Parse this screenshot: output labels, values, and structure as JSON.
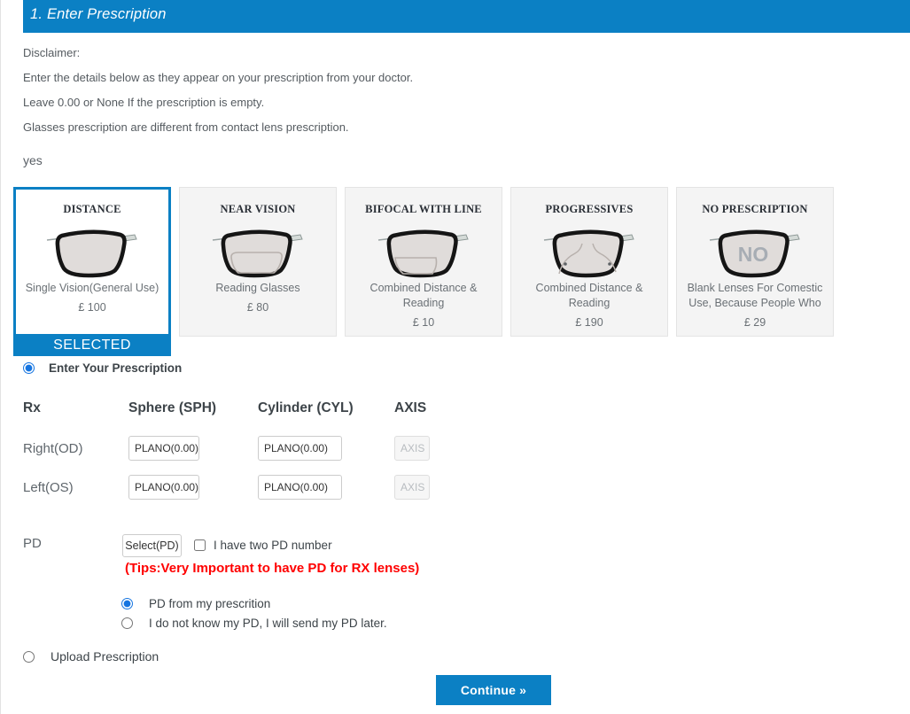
{
  "header": {
    "title": "1. Enter Prescription"
  },
  "disclaimer": {
    "lines": [
      "Disclaimer:",
      "Enter the details below as they appear on your prescription from your doctor.",
      "Leave 0.00 or None If the prescription is empty.",
      "Glasses prescription are different from contact lens prescription."
    ],
    "note": "yes"
  },
  "lens_cards": [
    {
      "title": "DISTANCE",
      "description": "Single Vision(General Use)",
      "price": "£ 100",
      "icon": "eyeglass-lens-plain-icon",
      "selected": true,
      "selected_label": "SELECTED"
    },
    {
      "title": "NEAR VISION",
      "description": "Reading Glasses",
      "price": "£ 80",
      "icon": "eyeglass-lens-reading-icon",
      "selected": false,
      "selected_label": ""
    },
    {
      "title": "BIFOCAL WITH LINE",
      "description": "Combined Distance & Reading",
      "price": "£ 10",
      "icon": "eyeglass-lens-bifocal-icon",
      "selected": false,
      "selected_label": ""
    },
    {
      "title": "PROGRESSIVES",
      "description": "Combined Distance & Reading",
      "price": "£ 190",
      "icon": "eyeglass-lens-progressive-icon",
      "selected": false,
      "selected_label": ""
    },
    {
      "title": "NO PRESCRIPTION",
      "description": "Blank Lenses For Comestic Use, Because People Who",
      "price": "£ 29",
      "icon": "eyeglass-lens-no-icon",
      "selected": false,
      "selected_label": ""
    }
  ],
  "prescription": {
    "enter_rx_label": "Enter Your Prescription",
    "enter_rx_checked": true,
    "columns": [
      "Rx",
      "Sphere (SPH)",
      "Cylinder (CYL)",
      "AXIS"
    ],
    "rows": [
      {
        "label": "Right(OD)",
        "sphere": "PLANO(0.00)",
        "cylinder": "PLANO(0.00)",
        "axis": "AXIS"
      },
      {
        "label": "Left(OS)",
        "sphere": "PLANO(0.00)",
        "cylinder": "PLANO(0.00)",
        "axis": "AXIS"
      }
    ]
  },
  "pd": {
    "label": "PD",
    "select_label": "Select(PD)",
    "two_pd_label": "I have two PD number",
    "two_pd_checked": false,
    "tips": "(Tips:Very Important to have PD for RX lenses)",
    "options": [
      {
        "label": "PD from my prescrition",
        "checked": true
      },
      {
        "label": "I do not know my PD, I will send my PD later.",
        "checked": false
      }
    ]
  },
  "upload": {
    "label": "Upload Prescription",
    "checked": false
  },
  "footer": {
    "continue_label": "Continue »"
  },
  "colors": {
    "brand_blue": "#0b80c4",
    "tips_red": "#ff0000",
    "card_bg": "#f4f4f4"
  }
}
